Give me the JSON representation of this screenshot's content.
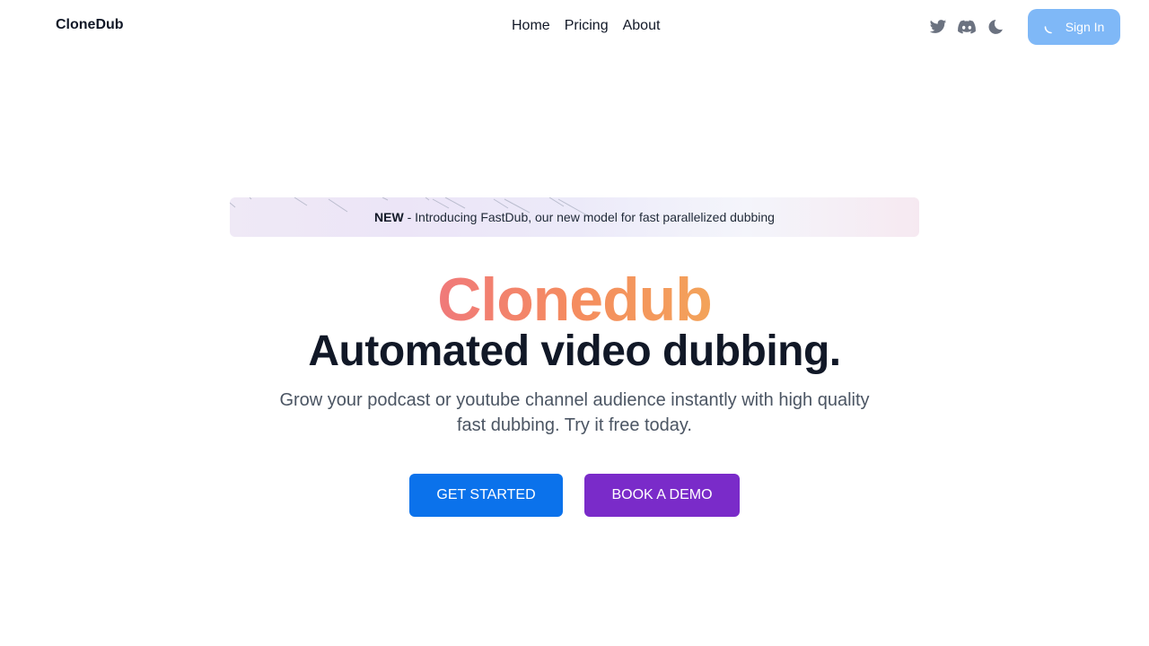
{
  "nav": {
    "brand": "CloneDub",
    "links": [
      {
        "label": "Home"
      },
      {
        "label": "Pricing"
      },
      {
        "label": "About"
      }
    ],
    "icons": [
      "twitter-icon",
      "discord-icon",
      "moon-icon"
    ],
    "signin_label": "Sign In"
  },
  "banner": {
    "tag": "NEW",
    "text": " - Introducing FastDub, our new model for fast parallelized dubbing"
  },
  "hero": {
    "brand": "Clonedub",
    "title": "Automated video dubbing.",
    "subtitle": "Grow your podcast or youtube channel audience instantly with high quality fast dubbing. Try it free today."
  },
  "cta": {
    "primary_label": "GET STARTED",
    "secondary_label": "BOOK A DEMO"
  },
  "colors": {
    "primary": "#0b72eb",
    "demo": "#7a2bc9",
    "signin": "#7fb8f7",
    "gradient_start": "#f0797a",
    "gradient_end": "#f3a35a"
  }
}
